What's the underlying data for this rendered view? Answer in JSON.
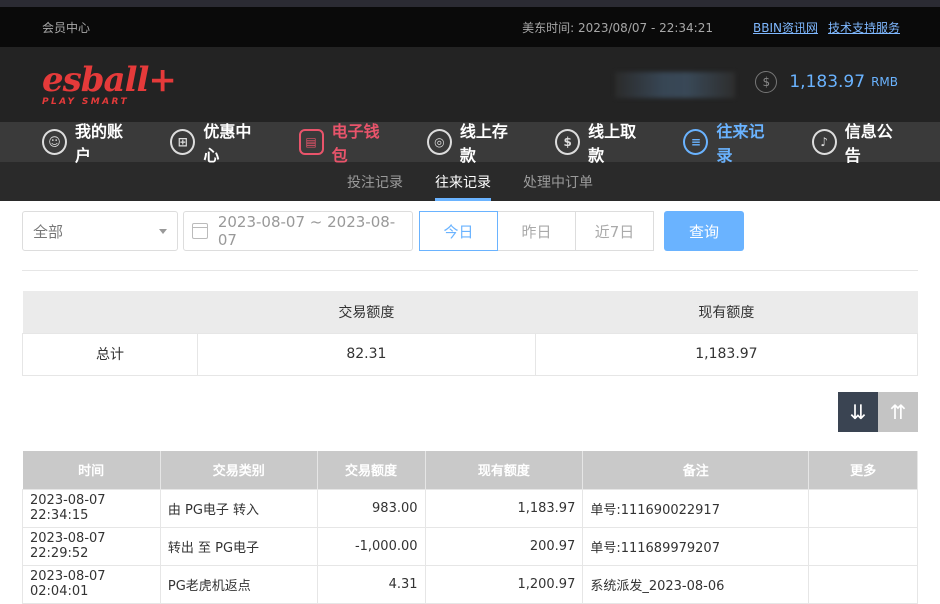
{
  "topbar": {
    "member_center": "会员中心",
    "time_label": "美东时间: 2023/08/07 - 22:34:21",
    "link_news": "BBIN资讯网",
    "link_support": "技术支持服务"
  },
  "header": {
    "logo_word": "esball+",
    "logo_tagline": "PLAY SMART",
    "balance_icon": "$",
    "balance": "1,183.97",
    "currency": "RMB"
  },
  "nav": [
    {
      "label": "我的账户",
      "icon": "user-icon",
      "glyph": "☺"
    },
    {
      "label": "优惠中心",
      "icon": "gift-icon",
      "glyph": "⊞"
    },
    {
      "label": "电子钱包",
      "icon": "wallet-icon",
      "glyph": "▤"
    },
    {
      "label": "线上存款",
      "icon": "deposit-icon",
      "glyph": "◎"
    },
    {
      "label": "线上取款",
      "icon": "withdraw-icon",
      "glyph": "$"
    },
    {
      "label": "往来记录",
      "icon": "records-icon",
      "glyph": "≡"
    },
    {
      "label": "信息公告",
      "icon": "bell-icon",
      "glyph": "♪"
    }
  ],
  "subnav": [
    "投注记录",
    "往来记录",
    "处理中订单"
  ],
  "filters": {
    "type_select": "全部",
    "date_range": "2023-08-07 ~ 2023-08-07",
    "today": "今日",
    "yesterday": "昨日",
    "last7": "近7日",
    "search": "查询"
  },
  "summary": {
    "col_amount": "交易额度",
    "col_balance": "现有额度",
    "row_label": "总计",
    "amount": "82.31",
    "balance": "1,183.97"
  },
  "records": {
    "headers": [
      "时间",
      "交易类别",
      "交易额度",
      "现有额度",
      "备注",
      "更多"
    ],
    "rows": [
      [
        "2023-08-07 22:34:15",
        "由 PG电子 转入",
        "983.00",
        "1,183.97",
        "单号:111690022917",
        ""
      ],
      [
        "2023-08-07 22:29:52",
        "转出 至 PG电子",
        "-1,000.00",
        "200.97",
        "单号:111689979207",
        ""
      ],
      [
        "2023-08-07 02:04:01",
        "PG老虎机返点",
        "4.31",
        "1,200.97",
        "系统派发_2023-08-06",
        ""
      ]
    ]
  },
  "colors": {
    "accent": "#6ab3ff",
    "brand_red": "#e53a3a",
    "wallet_red": "#e9546b"
  }
}
